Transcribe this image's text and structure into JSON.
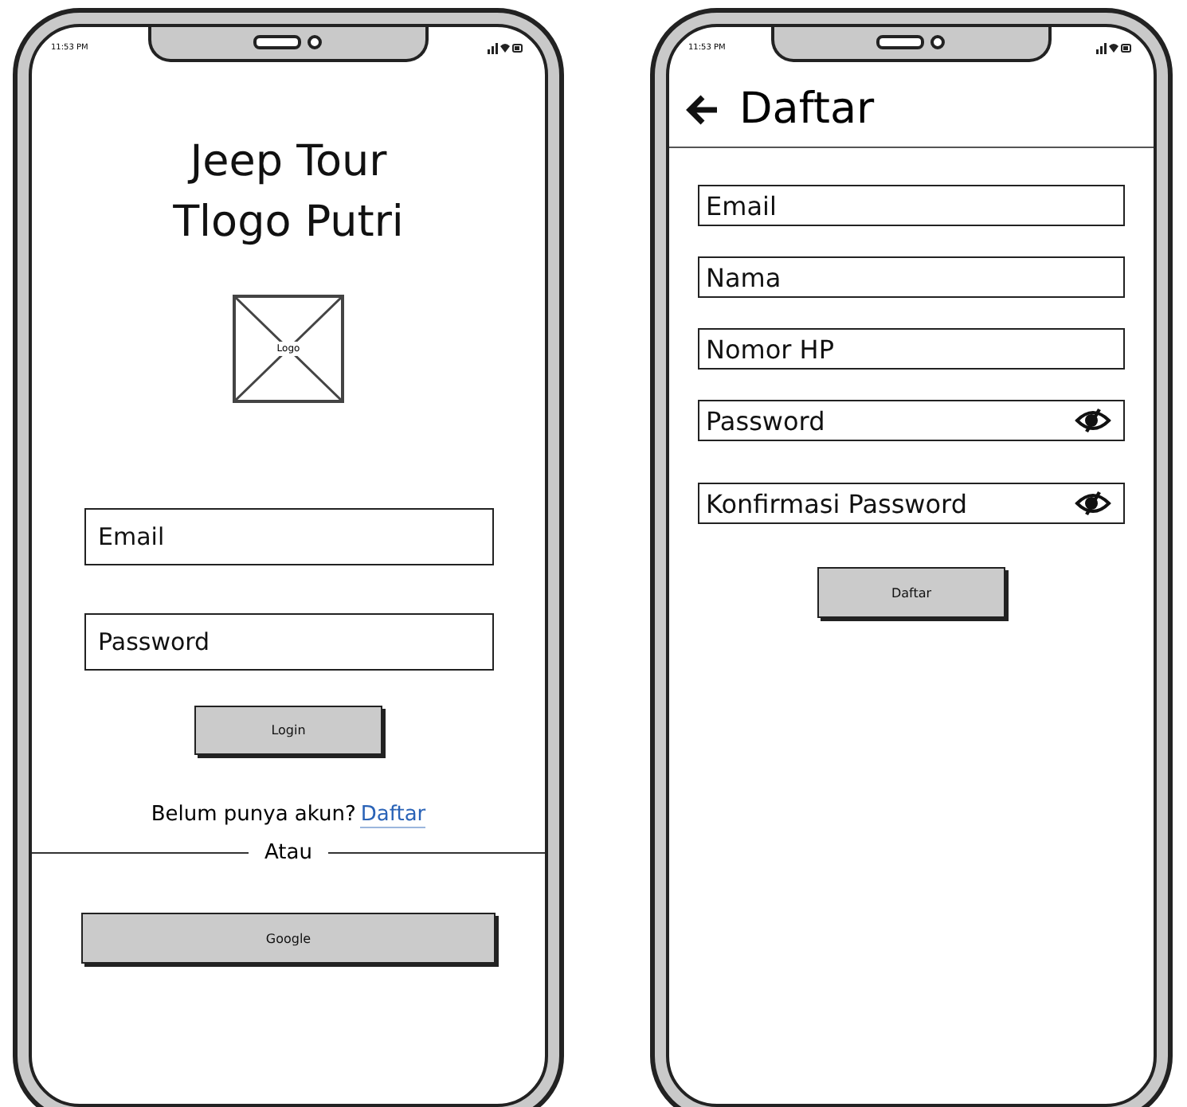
{
  "login_screen": {
    "status_time": "11:53 PM",
    "title_lines": [
      "Jeep Tour",
      "Tlogo Putri"
    ],
    "logo_label": "Logo",
    "fields": [
      {
        "kind": "text",
        "placeholder": "Email"
      },
      {
        "kind": "text",
        "placeholder": "Password"
      }
    ],
    "button": "Login",
    "prompt": "Belum punya akun?",
    "link": "Daftar",
    "divider": "Atau",
    "google_button": "Google"
  },
  "register_screen": {
    "status_time": "11:53 PM",
    "title": "Daftar",
    "fields": [
      {
        "kind": "text",
        "placeholder": "Email"
      },
      {
        "kind": "text",
        "placeholder": "Nama"
      },
      {
        "kind": "text",
        "placeholder": "Nomor HP"
      },
      {
        "kind": "password",
        "placeholder": "Password"
      },
      {
        "kind": "password",
        "placeholder": "Konfirmasi Password"
      }
    ],
    "button": "Daftar"
  }
}
